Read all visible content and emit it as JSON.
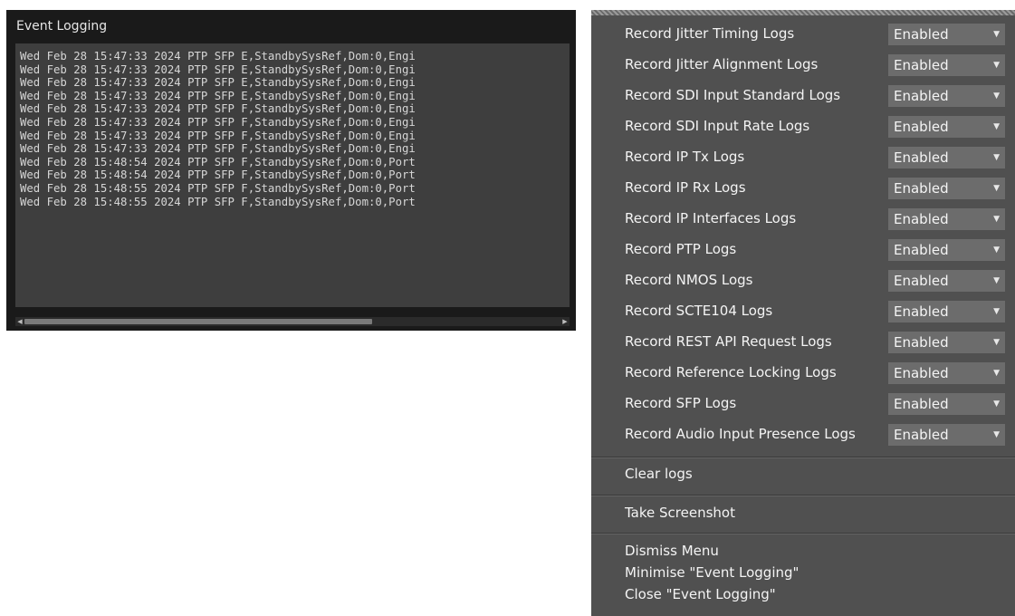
{
  "log_window": {
    "title": "Event Logging",
    "lines": [
      "Wed Feb 28 15:47:33 2024 PTP SFP E,StandbySysRef,Dom:0,Engi",
      "Wed Feb 28 15:47:33 2024 PTP SFP E,StandbySysRef,Dom:0,Engi",
      "Wed Feb 28 15:47:33 2024 PTP SFP E,StandbySysRef,Dom:0,Engi",
      "Wed Feb 28 15:47:33 2024 PTP SFP E,StandbySysRef,Dom:0,Engi",
      "Wed Feb 28 15:47:33 2024 PTP SFP F,StandbySysRef,Dom:0,Engi",
      "Wed Feb 28 15:47:33 2024 PTP SFP F,StandbySysRef,Dom:0,Engi",
      "Wed Feb 28 15:47:33 2024 PTP SFP F,StandbySysRef,Dom:0,Engi",
      "Wed Feb 28 15:47:33 2024 PTP SFP F,StandbySysRef,Dom:0,Engi",
      "Wed Feb 28 15:48:54 2024 PTP SFP F,StandbySysRef,Dom:0,Port",
      "Wed Feb 28 15:48:54 2024 PTP SFP F,StandbySysRef,Dom:0,Port",
      "Wed Feb 28 15:48:55 2024 PTP SFP F,StandbySysRef,Dom:0,Port",
      "Wed Feb 28 15:48:55 2024 PTP SFP F,StandbySysRef,Dom:0,Port"
    ],
    "scroll_left_icon": "left-arrow-icon",
    "scroll_right_icon": "right-arrow-icon"
  },
  "menu": {
    "settings": [
      {
        "label": "Record Jitter Timing Logs",
        "value": "Enabled"
      },
      {
        "label": "Record Jitter Alignment Logs",
        "value": "Enabled"
      },
      {
        "label": "Record SDI Input Standard Logs",
        "value": "Enabled"
      },
      {
        "label": "Record SDI Input Rate Logs",
        "value": "Enabled"
      },
      {
        "label": "Record IP Tx Logs",
        "value": "Enabled"
      },
      {
        "label": "Record IP Rx Logs",
        "value": "Enabled"
      },
      {
        "label": "Record IP Interfaces Logs",
        "value": "Enabled"
      },
      {
        "label": "Record PTP Logs",
        "value": "Enabled"
      },
      {
        "label": "Record NMOS Logs",
        "value": "Enabled"
      },
      {
        "label": "Record SCTE104 Logs",
        "value": "Enabled"
      },
      {
        "label": "Record REST API Request Logs",
        "value": "Enabled"
      },
      {
        "label": "Record Reference Locking Logs",
        "value": "Enabled"
      },
      {
        "label": "Record SFP Logs",
        "value": "Enabled"
      },
      {
        "label": "Record Audio Input Presence Logs",
        "value": "Enabled"
      }
    ],
    "dropdown_icon": "chevron-down-icon",
    "clear_logs": "Clear logs",
    "take_screenshot": "Take Screenshot",
    "dismiss_menu": "Dismiss Menu",
    "minimise": "Minimise \"Event Logging\"",
    "close": "Close \"Event Logging\""
  },
  "colors": {
    "window_bg": "#1a1a1a",
    "log_pane_bg": "#3e3e3e",
    "menu_bg": "#505050",
    "select_bg": "#6c6c6c"
  }
}
